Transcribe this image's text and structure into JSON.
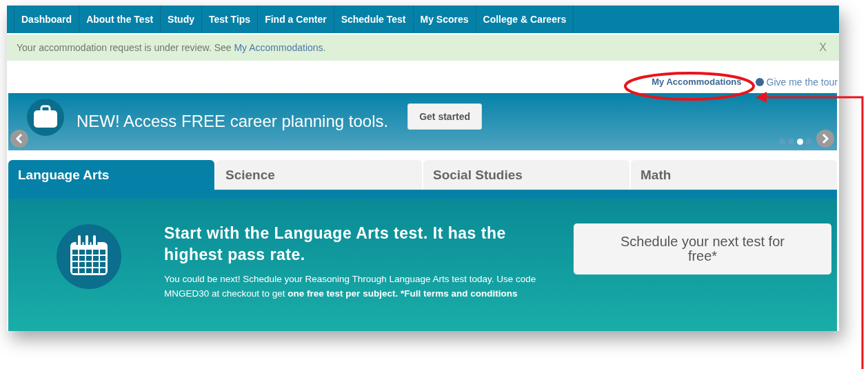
{
  "nav": [
    {
      "label": "Dashboard"
    },
    {
      "label": "About the Test"
    },
    {
      "label": "Study"
    },
    {
      "label": "Test Tips"
    },
    {
      "label": "Find a Center"
    },
    {
      "label": "Schedule Test"
    },
    {
      "label": "My Scores"
    },
    {
      "label": "College & Careers"
    }
  ],
  "alert": {
    "text": "Your accommodation request is under review. See ",
    "link": "My Accommodations",
    "suffix": ".",
    "close": "X"
  },
  "links": [
    {
      "label": "My Accommodations",
      "kind": "link"
    },
    {
      "label": "Give me the tour",
      "kind": "help"
    }
  ],
  "banner": {
    "text": "NEW! Access FREE career planning tools.",
    "button": "Get started",
    "dots": [
      {
        "selected": false
      },
      {
        "selected": false
      },
      {
        "selected": true
      },
      {
        "selected": false
      }
    ]
  },
  "tabs": [
    {
      "label": "Language Arts",
      "selected": true
    },
    {
      "label": "Science",
      "selected": false
    },
    {
      "label": "Social Studies",
      "selected": false
    },
    {
      "label": "Math",
      "selected": false
    }
  ],
  "panel": {
    "heading": "Start with the Language Arts test. It has the highest pass rate.",
    "body": "You could be next! Schedule your Reasoning Through Language Arts test today. Use code MNGED30 at checkout to get **one free test per subject. *Full terms and conditions**",
    "button": "Schedule your next test for free*"
  }
}
